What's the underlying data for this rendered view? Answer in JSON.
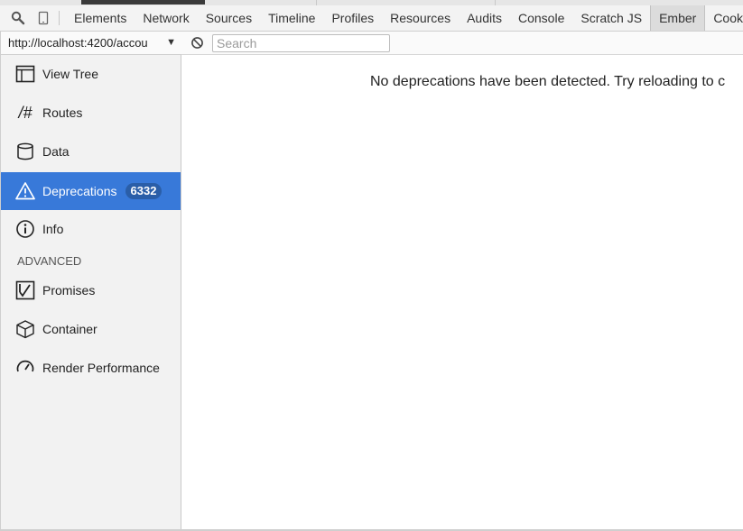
{
  "devtools": {
    "tabs": [
      "Elements",
      "Network",
      "Sources",
      "Timeline",
      "Profiles",
      "Resources",
      "Audits",
      "Console",
      "Scratch JS",
      "Ember",
      "Cookie"
    ],
    "active_tab": "Ember",
    "icons": [
      "search-icon",
      "device-mode-icon"
    ]
  },
  "sidebar": {
    "url": "http://localhost:4200/accou",
    "items": [
      {
        "label": "View Tree",
        "icon": "view-tree-icon"
      },
      {
        "label": "Routes",
        "icon": "routes-icon"
      },
      {
        "label": "Data",
        "icon": "data-cylinder-icon"
      },
      {
        "label": "Deprecations",
        "icon": "warning-triangle-icon",
        "badge": "6332",
        "active": true
      },
      {
        "label": "Info",
        "icon": "info-icon"
      }
    ],
    "section": "ADVANCED",
    "advanced_items": [
      {
        "label": "Promises",
        "icon": "promises-icon"
      },
      {
        "label": "Container",
        "icon": "container-cube-icon"
      },
      {
        "label": "Render Performance",
        "icon": "gauge-icon"
      }
    ]
  },
  "toolbar": {
    "search_placeholder": "Search",
    "clear_icon": "clear-circle-icon"
  },
  "main": {
    "message": "No deprecations have been detected. Try reloading to c"
  },
  "colors": {
    "active_bg": "#3879d9",
    "badge_bg": "#2a5ea8"
  }
}
